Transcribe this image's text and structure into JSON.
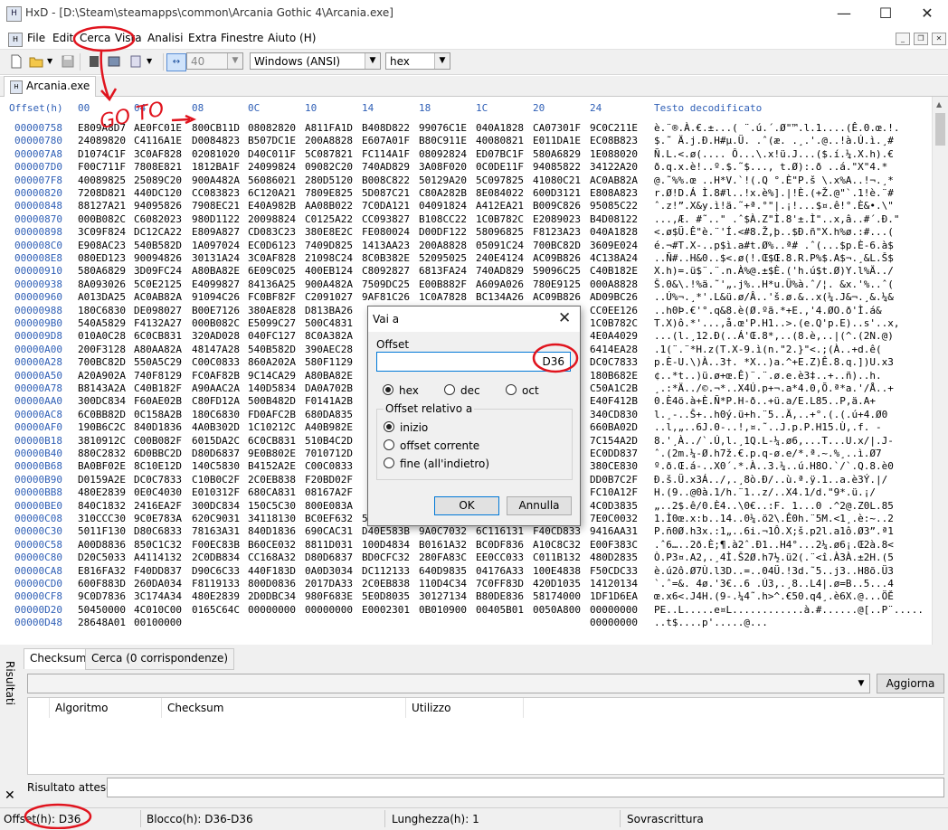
{
  "window": {
    "title": "HxD - [D:\\Steam\\steamapps\\common\\Arcania Gothic 4\\Arcania.exe]",
    "minimize": "—",
    "maximize": "☐",
    "close": "✕"
  },
  "menu": [
    "File",
    "Edit",
    "Cerca",
    "Vista",
    "Analisi",
    "Extra",
    "Finestre",
    "Aiuto (H)"
  ],
  "toolbar": {
    "bytes_per_row": "40",
    "charset": "Windows (ANSI)",
    "offset_base": "hex"
  },
  "file_tab": "Arcania.exe",
  "hex": {
    "offset_label": "Offset(h)",
    "columns": [
      "00",
      "04",
      "08",
      "0C",
      "10",
      "14",
      "18",
      "1C",
      "20",
      "24"
    ],
    "text_label": "Testo decodificato",
    "rows": [
      {
        "off": "00000758",
        "g": [
          "E809A8D7",
          "AE0FC01E",
          "800CB11D",
          "08082820",
          "A811FA1D",
          "B408D822",
          "99076C1E",
          "040A1828",
          "CA07301F",
          "9C0C211E"
        ],
        "t": "è.¨®.À.€.±...( ¨.ú.´.Ø\"™.l.1....(Ê.0.œ.!."
      },
      {
        "off": "00000780",
        "g": [
          "24089820",
          "C4116A1E",
          "D0084823",
          "B507DC1E",
          "200A8828",
          "E607A01F",
          "B80C911E",
          "40080821",
          "E011DA1E",
          "EC08B823"
        ],
        "t": "$.˜ Ä.j.Ð.H#µ.Ü. .ˆ(æ. .¸.'.@..!à.Ú.ì.¸#"
      },
      {
        "off": "000007A8",
        "g": [
          "D1074C1F",
          "3C0AF828",
          "02081020",
          "D40C011F",
          "5C087821",
          "FC114A1F",
          "08092824",
          "ED07BC1F",
          "580A6829",
          "1E088020"
        ],
        "t": "Ñ.L.<.ø(.... Ô...\\.x!ü.J...($.í.¼.X.h).€ "
      },
      {
        "off": "000007D0",
        "g": [
          "F00C711F",
          "7808E821",
          "1812BA1F",
          "24099824",
          "09082C20",
          "740AD829",
          "3A08F020",
          "0C0DE11F",
          "94085822",
          "34122A20"
        ],
        "t": "ð.q.x.è!..º.$.˜$..., t.Ø):.ð ..á.\"X\"4.* "
      },
      {
        "off": "000007F8",
        "g": [
          "40089825",
          "25089C20",
          "900A482A",
          "56086021",
          "280D5120",
          "B008C822",
          "50129A20",
          "5C097825",
          "41080C21",
          "AC0AB82A"
        ],
        "t": "@.˜%%.œ ..H*V.`!(.Q °.È\"P.š \\.x%A..!¬.¸*"
      },
      {
        "off": "00000820",
        "g": [
          "7208D821",
          "440DC120",
          "CC083823",
          "6C120A21",
          "7809E825",
          "5D087C21",
          "C80A282B",
          "8E084022",
          "600D3121",
          "E808A823"
        ],
        "t": "r.Ø!D.Á Ì.8#l..!x.è%].|!È.(+Ž.@\"`.1!è.¨#"
      },
      {
        "off": "00000848",
        "g": [
          "88127A21",
          "94095826",
          "7908EC21",
          "E40A982B",
          "AA08B022",
          "7C0DA121",
          "04091824",
          "A412EA21",
          "B009C826",
          "95085C22"
        ],
        "t": "ˆ.z!”.X&y.ì!ä.˜+ª.°\"|.¡!...$¤.ê!°.È&•.\\\""
      },
      {
        "off": "00000870",
        "g": [
          "000B082C",
          "C6082023",
          "980D1122",
          "20098824",
          "C0125A22",
          "CC093827",
          "B108CC22",
          "1C0B782C",
          "E2089023",
          "B4D08122"
        ],
        "t": "...,Æ. #˜..\" .ˆ$À.Z\"Ì.8'±.Ì\"..x,â..#´.Ð.\""
      },
      {
        "off": "00000898",
        "g": [
          "3C09F824",
          "DC12CA22",
          "E809A827",
          "CD083C23",
          "380E8E2C",
          "FE080024",
          "D00DF122",
          "58096825",
          "F8123A23",
          "040A1828"
        ],
        "t": "<.ø$Ü.Ê\"è.¨'Í.<#8.Ž,þ..$Ð.ñ\"X.h%ø.:#...("
      },
      {
        "off": "000008C0",
        "g": [
          "E908AC23",
          "540B582D",
          "1A097024",
          "EC0D6123",
          "7409D825",
          "1413AA23",
          "200A8828",
          "05091C24",
          "700BC82D",
          "3609E024"
        ],
        "t": "é.¬#T.X-..p$ì.a#t.Ø%..ª# .ˆ(...$p.È-6.à$"
      },
      {
        "off": "000008E8",
        "g": [
          "080ED123",
          "90094826",
          "30131A24",
          "3C0AF828",
          "21098C24",
          "8C0B382E",
          "52095025",
          "240E4124",
          "AC09B826",
          "4C138A24"
        ],
        "t": "..Ñ#..H&0..$<.ø(!.Œ$Œ.8.R.P%$.A$¬.¸&L.Š$"
      },
      {
        "off": "00000910",
        "g": [
          "580A6829",
          "3D09FC24",
          "A80BA82E",
          "6E09C025",
          "400EB124",
          "C8092827",
          "6813FA24",
          "740AD829",
          "59096C25",
          "C40B182E"
        ],
        "t": "X.h)=.ü$¨.¨.n.À%@.±$È.('h.ú$t.Ø)Y.l%Ä../"
      },
      {
        "off": "00000938",
        "g": [
          "8A093026",
          "5C0E2125",
          "E4099827",
          "84136A25",
          "900A482A",
          "7509DC25",
          "E00B882F",
          "A609A026",
          "780E9125",
          "000A8828"
        ],
        "t": "Š.0&\\.!%ä.˜'„.j%..H*u.Ü%à.ˆ/¦. &x.'%..ˆ("
      },
      {
        "off": "00000960",
        "g": [
          "A013DA25",
          "AC0AB82A",
          "91094C26",
          "FC0BF82F",
          "C2091027",
          "9AF81C26",
          "1C0A7828",
          "BC134A26",
          "AC09B826",
          "AD09BC26"
        ],
        "t": "..Ú%¬.¸*'.L&ü.ø/Â..'š.ø.&..x(¼.J&¬.¸&­.¼&"
      },
      {
        "off": "00000988",
        "g": [
          "180C6830",
          "DE098027",
          "B00E7126",
          "380AE828",
          "D813BA26",
          "",
          "",
          "",
          "",
          "CC0EE126"
        ],
        "t": "..h0Þ.€'°.q&8.è(Ø.ºã.*+E.,'4.ØO.ð'Ì.á&"
      },
      {
        "off": "000009B0",
        "g": [
          "540A5829",
          "F4132A27",
          "000B082C",
          "E5099C27",
          "500C4831",
          "",
          "",
          "",
          "",
          "1C0B782C"
        ],
        "t": "T.X)ô.*'...,å.œ'P.H1..>.(e.Q'p.E)..s'..x,"
      },
      {
        "off": "000009D8",
        "g": [
          "010A0C28",
          "6C0CB831",
          "320AD028",
          "040FC127",
          "8C0A382A",
          "",
          "",
          "",
          "",
          "4E0A4029"
        ],
        "t": "...(l.¸12.Ð(..Á'Œ.8*,..(8.è,..|(^.(2N.@)"
      },
      {
        "off": "00000A00",
        "g": [
          "200F3128",
          "A80AA82A",
          "48147A28",
          "540B582D",
          "390AEC28",
          "",
          "",
          "",
          "",
          "6414EA28"
        ],
        "t": " .1(¨.¨*H.z(T.X-9.ì(n.\"2.}\"<.;(À..+d.ê("
      },
      {
        "off": "00000A28",
        "g": [
          "700BC82D",
          "550A5C29",
          "C00C0833",
          "860A202A",
          "580F1129",
          "",
          "",
          "",
          "",
          "DC0C7833"
        ],
        "t": "p.È-U.\\)À..3†. *X..)a.^+E.Z)Ê.8.q.])U.x3"
      },
      {
        "off": "00000A50",
        "g": [
          "A20A902A",
          "740F8129",
          "FC0AF82B",
          "9C14CA29",
          "A80BA82E",
          "",
          "",
          "",
          "",
          "180B682E"
        ],
        "t": "¢..*t..)ü.ø+œ.Ê)¨.¨.ø.e.è3‡..+..ñ)..h."
      },
      {
        "off": "00000A78",
        "g": [
          "B8143A2A",
          "C40B182F",
          "A90AAC2A",
          "140D5834",
          "DA0A702B",
          "",
          "",
          "",
          "",
          "C50A1C2B"
        ],
        "t": "¸.:*Ä../©.¬*..X4Ú.p+¬.a*4.0,Õ.ª*a.'/Å..+"
      },
      {
        "off": "00000AA0",
        "g": [
          "300DC834",
          "F60AE02B",
          "C80FD12A",
          "500B482D",
          "F0141A2B",
          "",
          "",
          "",
          "",
          "E40F412B"
        ],
        "t": "0.È4ö.à+È.Ñ*P.H-ð..+ü.a/E.L85..P,ä.A+"
      },
      {
        "off": "00000AC8",
        "g": [
          "6C0BB82D",
          "0C158A2B",
          "180C6830",
          "FD0AFC2B",
          "680DA835",
          "",
          "",
          "",
          "",
          "340CD830"
        ],
        "t": "l.¸-..Š+..h0ý.ü+h.¨5..Ä,..+°.(.(.ú+4.Ø0"
      },
      {
        "off": "00000AF0",
        "g": [
          "190B6C2C",
          "840D1836",
          "4A0B302D",
          "1C10212C",
          "A40B982E",
          "",
          "",
          "",
          "",
          "660BA02D"
        ],
        "t": "..l,„..6J.0-..!,¤.˜..J.p.P.H15.Ù,.f. -"
      },
      {
        "off": "00000B18",
        "g": [
          "3810912C",
          "C00B082F",
          "6015DA2C",
          "6C0CB831",
          "510B4C2D",
          "",
          "",
          "",
          "",
          "7C154A2D"
        ],
        "t": "8.'¸À../`.Ú,l.¸1Q.L-¼.ø6,...T...U.x/|.J-"
      },
      {
        "off": "00000B40",
        "g": [
          "880C2832",
          "6D0BBC2D",
          "D80D6837",
          "9E0B802E",
          "7010712D",
          "",
          "",
          "",
          "",
          "EC0DD837"
        ],
        "t": "ˆ.(2m.¼-Ø.h7ž.€.p.q-ø.e/*.ª.~.%¸..ì.Ø7"
      },
      {
        "off": "00000B68",
        "g": [
          "BA0BF02E",
          "8C10E12D",
          "140C5830",
          "B4152A2E",
          "C00C0833",
          "",
          "",
          "",
          "",
          "380CE830"
        ],
        "t": "º.ð.Œ.á-..X0´.*.À..3.¼..ú.H8O.`/`.Q.8.è0"
      },
      {
        "off": "00000B90",
        "g": [
          "D0159A2E",
          "DC0C7833",
          "C10B0C2F",
          "2C0EB838",
          "F20BD02F",
          "",
          "",
          "",
          "",
          "DD0B7C2F"
        ],
        "t": "Ð.š.Ü.x3Á../,.¸8ò.Ð/..ù.ª.ÿ.1..a.è3Ý.|/"
      },
      {
        "off": "00000BB8",
        "g": [
          "480E2839",
          "0E0C4030",
          "E010312F",
          "680CA831",
          "08167A2F",
          "",
          "",
          "",
          "",
          "FC10A12F"
        ],
        "t": "H.(9..@0à.1/h.¨1..z/..X4.1/d.\"9*.ü.¡/"
      },
      {
        "off": "00000BE0",
        "g": [
          "840C1832",
          "2416EA2F",
          "300DC834",
          "150C5C30",
          "800E083A",
          "",
          "",
          "",
          "",
          "4C0D3835"
        ],
        "t": "„..2$.ê/0.È4..\\0€..:F. 1...0 .^2@.Z0L.85"
      },
      {
        "off": "00000C08",
        "g": [
          "310CCC30",
          "9C0E783A",
          "620C9031",
          "34118130",
          "BC0EF632",
          "5C16CA30",
          "680DA835",
          "4D0C3C31",
          "B80EE83A",
          "7E0C0032"
        ],
        "t": "1.Ì0œ.x:b..14..0¼.ö2\\.Ê0h.¨5M.<1¸.è:~..2"
      },
      {
        "off": "00000C30",
        "g": [
          "5011F130",
          "D80C6833",
          "78163A31",
          "840D1836",
          "690CAC31",
          "D40E583B",
          "9A0C7032",
          "6C116131",
          "F40CD833",
          "9416AA31"
        ],
        "t": "P.ñ0Ø.h3x.:1„..6i.¬1Ô.X;š.p2l.a1ô.Ø3”.ª1"
      },
      {
        "off": "00000C58",
        "g": [
          "A00D8836",
          "850C1C32",
          "F00EC83B",
          "B60CE032",
          "8811D031",
          "100D4834",
          "B0161A32",
          "BC0DF836",
          "A10C8C32",
          "E00F383C"
        ],
        "t": " .ˆ6…..2ð.È;¶.à2ˆ.Ð1..H4°...2¼.ø6¡.Œ2à.8<"
      },
      {
        "off": "00000C80",
        "g": [
          "D20C5033",
          "A4114132",
          "2C0DB834",
          "CC168A32",
          "D80D6837",
          "BD0CFC32",
          "280FA83C",
          "EE0CC033",
          "C011B132",
          "480D2835"
        ],
        "t": "Ò.P3¤.A2,.¸4Ì.Š2Ø.h7½.ü2(.¨<î.À3À.±2H.(5"
      },
      {
        "off": "00000CA8",
        "g": [
          "E816FA32",
          "F40DD837",
          "D90C6C33",
          "440F183D",
          "0A0D3034",
          "DC112133",
          "640D9835",
          "04176A33",
          "100E4838",
          "F50CDC33"
        ],
        "t": "è.ú2ô.Ø7Ù.l3D..=..04Ü.!3d.˜5..j3..H8õ.Ü3"
      },
      {
        "off": "00000CD0",
        "g": [
          "600F883D",
          "260DA034",
          "F8119133",
          "800D0836",
          "2017DA33",
          "2C0EB838",
          "110D4C34",
          "7C0FF83D",
          "420D1035",
          "14120134"
        ],
        "t": "`.ˆ=&. 4ø.'3€..6 .Ú3,.¸8..L4|.ø=B..5...4"
      },
      {
        "off": "00000CF8",
        "g": [
          "9C0D7836",
          "3C174A34",
          "480E2839",
          "2D0DBC34",
          "980F683E",
          "5E0D8035",
          "30127134",
          "B80DE836",
          "58174000",
          "1DF1D6EA"
        ],
        "t": "œ.x6<.J4H.(9-.¼4˜.h>^.€50.q4¸.è6X.@...ÖĚ"
      },
      {
        "off": "00000D20",
        "g": [
          "50450000",
          "4C010C00",
          "0165C64C",
          "00000000",
          "00000000",
          "E0002301",
          "0B010900",
          "00405B01",
          "0050A800",
          "00000000"
        ],
        "t": "PE..L.....e¤L............à.#......@[..P¨....."
      },
      {
        "off": "00000D48",
        "g": [
          "28648A01",
          "00100000",
          "",
          "",
          "",
          "",
          "",
          "",
          "",
          "00000000"
        ],
        "t": "..t$....p'.....@..."
      }
    ]
  },
  "dialog": {
    "title": "Vai a",
    "offset_label": "Offset",
    "offset_value": "D36",
    "radix": [
      {
        "label": "hex",
        "checked": true
      },
      {
        "label": "dec",
        "checked": false
      },
      {
        "label": "oct",
        "checked": false
      }
    ],
    "relative_label": "Offset relativo a",
    "relative": [
      {
        "label": "inizio",
        "checked": true
      },
      {
        "label": "offset corrente",
        "checked": false
      },
      {
        "label": "fine (all'indietro)",
        "checked": false
      }
    ],
    "ok": "OK",
    "cancel": "Annulla"
  },
  "side_label": "Risultati",
  "panel": {
    "tabs": [
      "Checksum",
      "Cerca (0 corrispondenze)"
    ],
    "refresh": "Aggiorna",
    "columns": [
      "Algoritmo",
      "Checksum",
      "Utilizzo"
    ],
    "expected_label": "Risultato atteso:"
  },
  "status": {
    "offset": "Offset(h): D36",
    "block": "Blocco(h): D36-D36",
    "length": "Lunghezza(h): 1",
    "mode": "Sovrascrittura"
  },
  "annotation_text": "GO TO"
}
